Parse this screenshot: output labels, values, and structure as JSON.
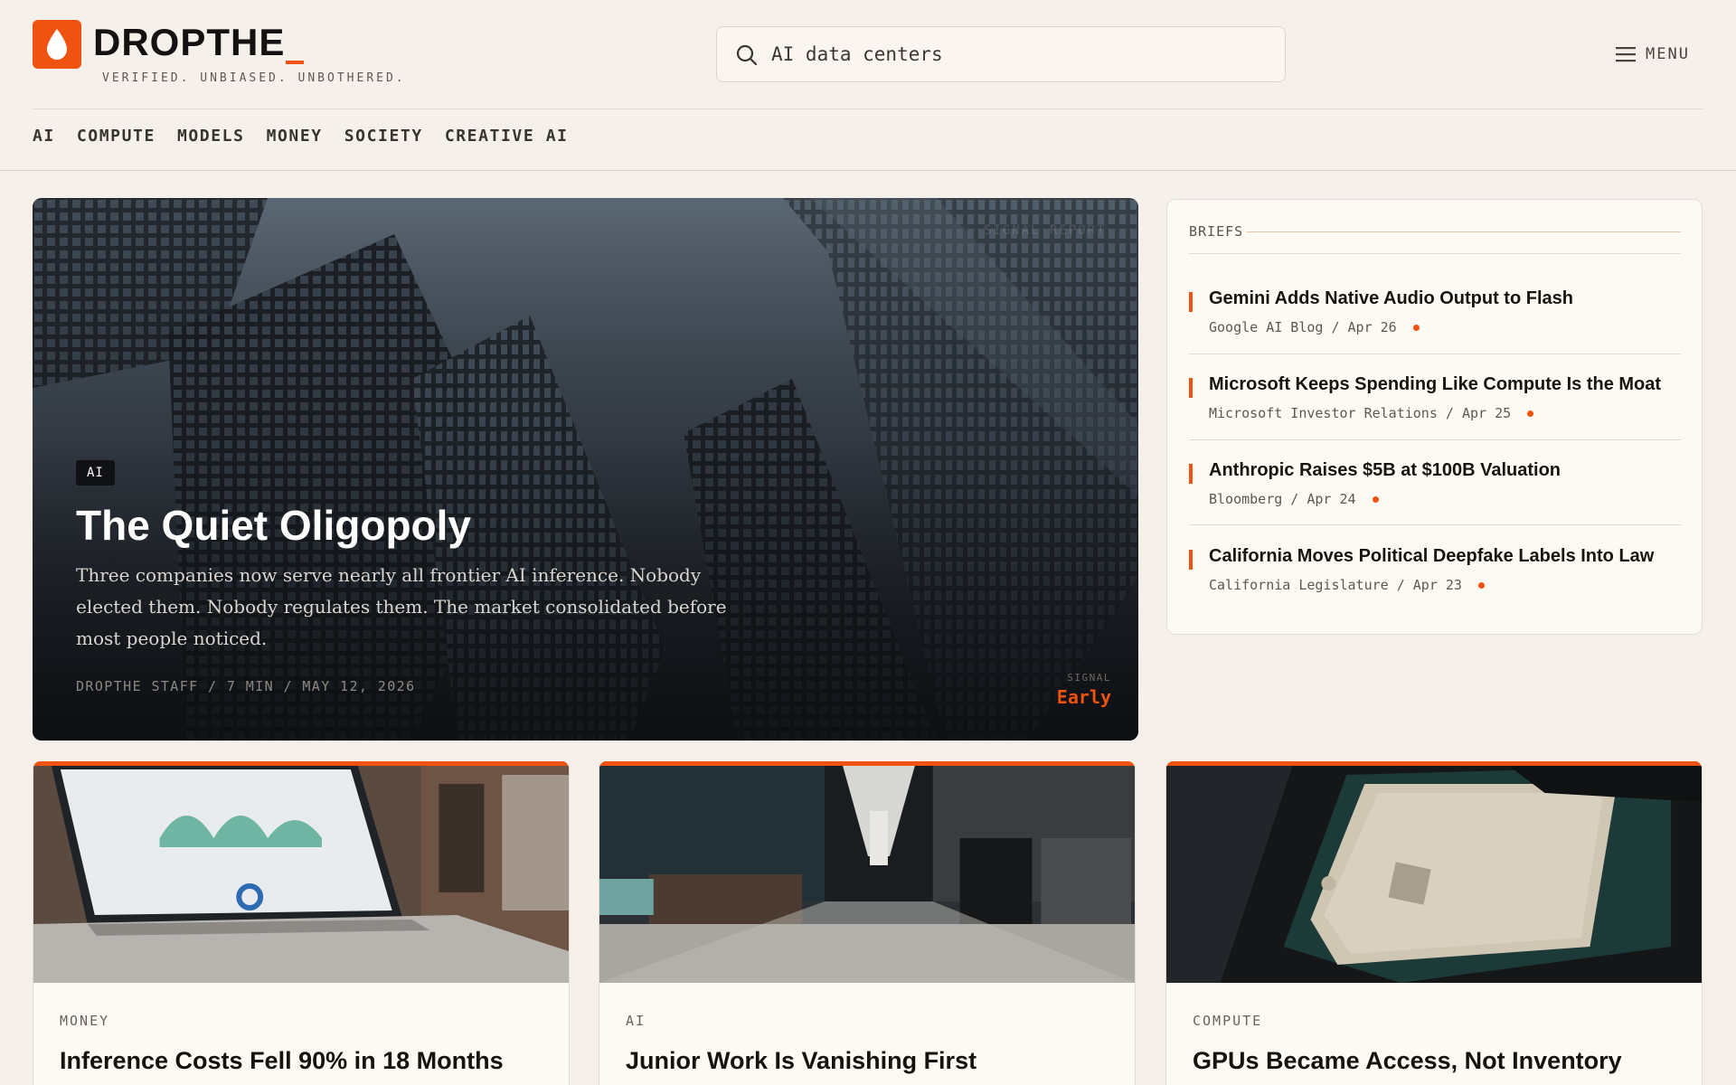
{
  "brand": {
    "name": "DROPTHE",
    "tagline": "VERIFIED. UNBIASED. UNBOTHERED.",
    "accent_color": "#f0520f",
    "logo_icon": "drop-icon"
  },
  "search": {
    "value": "AI data centers",
    "icon": "search-icon"
  },
  "menu": {
    "label": "MENU",
    "icon": "hamburger-icon"
  },
  "nav": {
    "items": [
      {
        "label": "AI"
      },
      {
        "label": "COMPUTE"
      },
      {
        "label": "MODELS"
      },
      {
        "label": "MONEY"
      },
      {
        "label": "SOCIETY"
      },
      {
        "label": "CREATIVE AI"
      }
    ]
  },
  "hero": {
    "kicker": "SIGNAL REPORT",
    "tag": "AI",
    "title": "The Quiet Oligopoly",
    "dek": "Three companies now serve nearly all frontier AI inference. Nobody elected them. Nobody regulates them. The market consolidated before most people noticed.",
    "byline": "DROPTHE STAFF  /  7 MIN  /  MAY 12, 2026",
    "signal_label": "SIGNAL",
    "signal_value": "Early"
  },
  "briefs": {
    "heading": "BRIEFS",
    "items": [
      {
        "title": "Gemini Adds Native Audio Output to Flash",
        "meta": "Google AI Blog  /  Apr 26"
      },
      {
        "title": "Microsoft Keeps Spending Like Compute Is the Moat",
        "meta": "Microsoft Investor Relations  /  Apr 25"
      },
      {
        "title": "Anthropic Raises $5B at $100B Valuation",
        "meta": "Bloomberg  /  Apr 24"
      },
      {
        "title": "California Moves Political Deepfake Labels Into Law",
        "meta": "California Legislature  /  Apr 23"
      }
    ]
  },
  "cards": [
    {
      "category": "MONEY",
      "title": "Inference Costs Fell 90% in 18 Months"
    },
    {
      "category": "AI",
      "title": "Junior Work Is Vanishing First"
    },
    {
      "category": "COMPUTE",
      "title": "GPUs Became Access, Not Inventory"
    }
  ]
}
